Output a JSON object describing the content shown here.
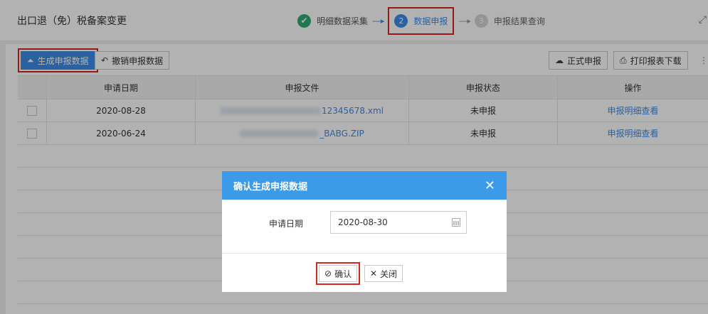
{
  "header": {
    "title": "出口退（免）税备案变更",
    "steps": [
      {
        "label": "明细数据采集",
        "state": "done"
      },
      {
        "num": "2",
        "label": "数据申报",
        "state": "active"
      },
      {
        "num": "3",
        "label": "申报结果查询",
        "state": "pending"
      }
    ]
  },
  "toolbar": {
    "generate_label": "生成申报数据",
    "revoke_label": "撤销申报数据",
    "formal_label": "正式申报",
    "print_label": "打印报表下载"
  },
  "table": {
    "columns": [
      "申请日期",
      "申报文件",
      "申报状态",
      "操作"
    ],
    "rows": [
      {
        "date": "2020-08-28",
        "file": "12345678.xml",
        "status": "未申报",
        "action": "申报明细查看"
      },
      {
        "date": "2020-06-24",
        "file": "_BABG.ZIP",
        "status": "未申报",
        "action": "申报明细查看"
      }
    ]
  },
  "modal": {
    "title": "确认生成申报数据",
    "field_label": "申请日期",
    "date_value": "2020-08-30",
    "confirm_label": "确认",
    "close_label": "关闭"
  },
  "colors": {
    "primary": "#3d8ce6",
    "modal_header": "#3b9be8",
    "highlight": "#d9251d",
    "done": "#2cae72"
  }
}
